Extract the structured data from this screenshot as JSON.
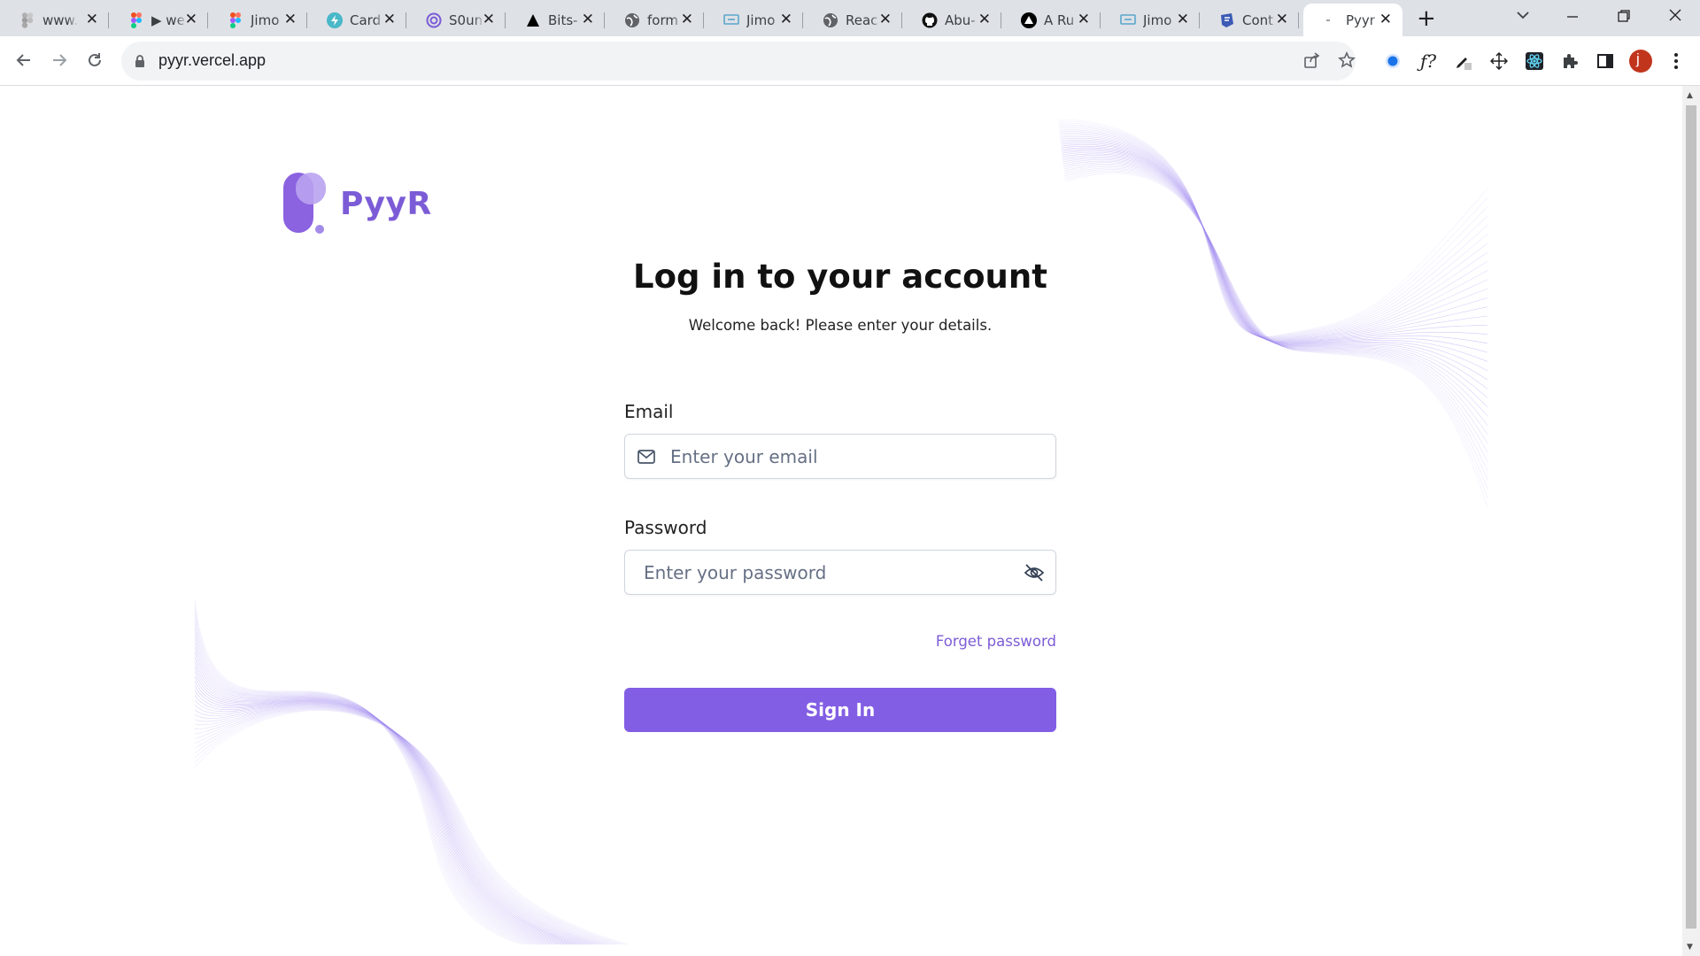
{
  "browser": {
    "tabs": [
      {
        "title": "www.",
        "icon": "figma-file-icon"
      },
      {
        "title": "▶ we",
        "icon": "figma-icon"
      },
      {
        "title": "Jimo",
        "icon": "figma-icon"
      },
      {
        "title": "Card",
        "icon": "bolt-circle-icon"
      },
      {
        "title": "S0un",
        "icon": "spiral-icon"
      },
      {
        "title": "Bits-",
        "icon": "triangle-icon"
      },
      {
        "title": "form",
        "icon": "globe-icon"
      },
      {
        "title": "Jimo",
        "icon": "monitor-icon"
      },
      {
        "title": "Reac",
        "icon": "globe-icon"
      },
      {
        "title": "Abu-",
        "icon": "github-icon"
      },
      {
        "title": "A Ru",
        "icon": "triangle-circle-icon"
      },
      {
        "title": "Jimo",
        "icon": "monitor-icon"
      },
      {
        "title": "Cont",
        "icon": "form-icon"
      },
      {
        "title": "Pyyr",
        "icon": "loading-icon",
        "active": true
      }
    ],
    "url": "pyyr.vercel.app",
    "profile_initial": "j"
  },
  "page": {
    "brand_name": "PyyR",
    "title": "Log in to your account",
    "subtitle": "Welcome back! Please enter your details.",
    "email": {
      "label": "Email",
      "placeholder": "Enter your email",
      "value": ""
    },
    "password": {
      "label": "Password",
      "placeholder": "Enter your password",
      "value": ""
    },
    "forgot_link": "Forget password",
    "signin_label": "Sign In"
  },
  "colors": {
    "accent": "#825ee4",
    "brand_text": "#7c5cd6",
    "wave": "#a18bf0"
  }
}
